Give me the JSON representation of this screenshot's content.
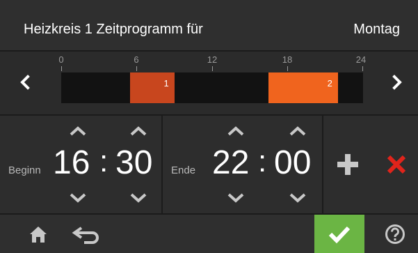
{
  "header": {
    "title": "Heizkreis 1 Zeitprogramm für",
    "day": "Montag"
  },
  "timeline": {
    "ticks": [
      "0",
      "6",
      "12",
      "18",
      "24"
    ],
    "segments": [
      {
        "label": "1",
        "start_hour": 5.5,
        "end_hour": 9.0,
        "color": "#c8461e"
      },
      {
        "label": "2",
        "start_hour": 16.5,
        "end_hour": 22.0,
        "color": "#f0641e"
      }
    ],
    "prev_icon": "chevron-left-icon",
    "next_icon": "chevron-right-icon"
  },
  "begin": {
    "label": "Beginn",
    "hours": "16",
    "separator": ":",
    "minutes": "30"
  },
  "end": {
    "label": "Ende",
    "hours": "22",
    "separator": ":",
    "minutes": "00"
  },
  "actions": {
    "add_icon": "plus-icon",
    "delete_icon": "x-icon",
    "delete_color": "#e0241b"
  },
  "footer": {
    "home_icon": "home-icon",
    "back_icon": "back-arrow-icon",
    "confirm_icon": "checkmark-icon",
    "confirm_color": "#6bb544",
    "help_icon": "question-icon"
  },
  "colors": {
    "header_bg": "#2f2f2f",
    "panel_bg": "#2d2d2d",
    "chevron": "#c8c8c8"
  }
}
